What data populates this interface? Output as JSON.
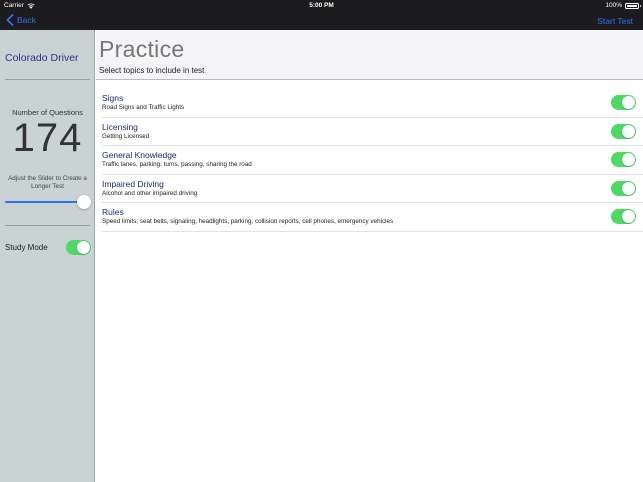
{
  "status_bar": {
    "carrier": "Carrier",
    "time": "5:00 PM",
    "battery": "100%"
  },
  "nav": {
    "back_label": "Back",
    "start_label": "Start Test",
    "tint_color": "#2e71f0"
  },
  "sidebar": {
    "title": "Colorado Driver",
    "questions_label": "Number of Questions",
    "questions_value": "174",
    "slider_hint": "Adjust the Slider to Create a Longer Test",
    "slider_value": 1.0,
    "study_mode_label": "Study Mode",
    "study_mode_on": true
  },
  "main": {
    "title": "Practice",
    "subtitle": "Select topics to include in test",
    "topics": [
      {
        "name": "Signs",
        "description": "Road Signs and Traffic Lights",
        "enabled": true
      },
      {
        "name": "Licensing",
        "description": "Getting Licensed",
        "enabled": true
      },
      {
        "name": "General Knowledge",
        "description": "Traffic lanes, parking, turns, passing, sharing the road",
        "enabled": true
      },
      {
        "name": "Impaired Driving",
        "description": "Alcohol and other impaired driving",
        "enabled": true
      },
      {
        "name": "Rules",
        "description": "Speed limits, seat belts, signaling, headlights, parking, collision reports, cell phones, emergency vehicles",
        "enabled": true
      }
    ]
  },
  "colors": {
    "toggle_on": "#4cd964",
    "sidebar_bg": "#c9d3d3",
    "sidebar_title": "#3a2c8c",
    "topic_title": "#1d2a6e"
  },
  "icons": {
    "wifi": "wifi-icon",
    "battery": "battery-icon",
    "back": "chevron-left-icon"
  }
}
